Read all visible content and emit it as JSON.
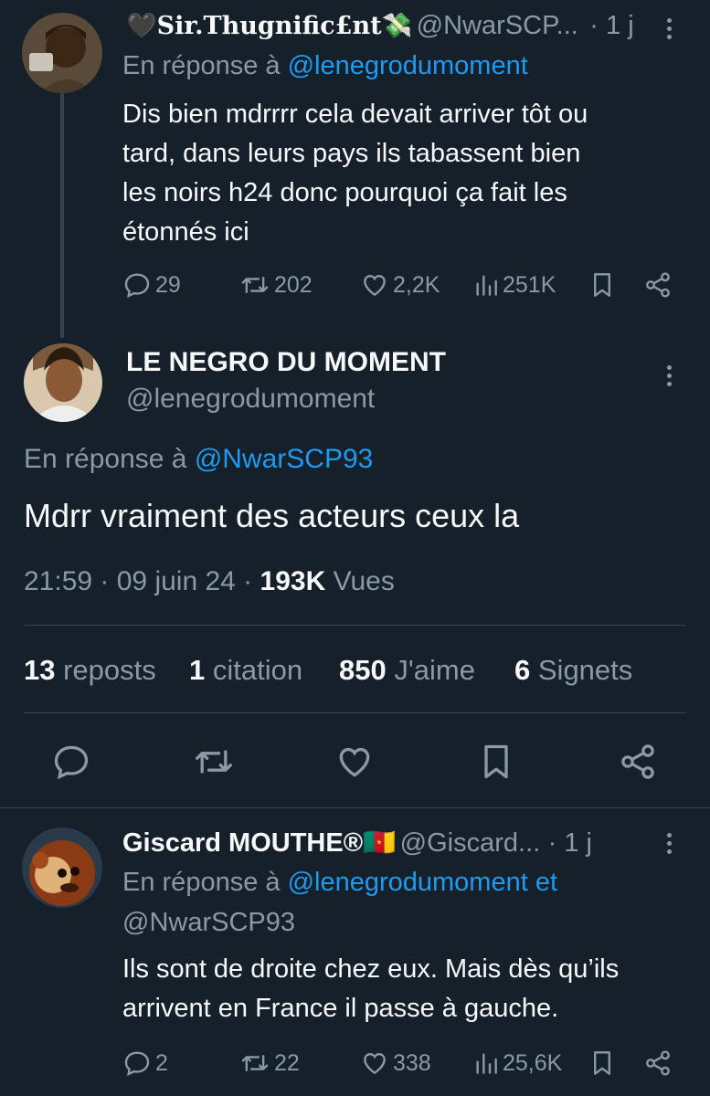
{
  "tweet1": {
    "display_name": "🖤Sir.Thugnific£nt💸",
    "handle": "@NwarSCP...",
    "time": "· 1 j",
    "reply_prefix": "En réponse à",
    "reply_to": "@lenegrodumoment",
    "text_lines": [
      "Dis bien mdrrrr cela devait arriver tôt ou",
      "tard, dans leurs pays ils tabassent bien",
      "les noirs h24 donc pourquoi ça fait les",
      "étonnés ici"
    ],
    "replies": "29",
    "reposts": "202",
    "likes": "2,2K",
    "views": "251K"
  },
  "main_tweet": {
    "display_name": "LE NEGRO DU MOMENT",
    "handle": "@lenegrodumoment",
    "reply_prefix": "En réponse à",
    "reply_to": "@NwarSCP93",
    "text": "Mdrr vraiment des acteurs ceux la",
    "timestamp": "21:59 · 09 juin 24 ·",
    "views_count": "193K",
    "views_label": "Vues",
    "stats": {
      "reposts_count": "13",
      "reposts_label": "reposts",
      "quotes_count": "1",
      "quotes_label": "citation",
      "likes_count": "850",
      "likes_label": "J'aime",
      "bookmarks_count": "6",
      "bookmarks_label": "Signets"
    }
  },
  "tweet3": {
    "display_name": "Giscard MOUTHE®🇨🇲",
    "handle": "@Giscard...",
    "time": "· 1 j",
    "reply_prefix": "En réponse à",
    "reply_to_1": "@lenegrodumoment et",
    "reply_to_2": "@NwarSCP93",
    "text_lines": [
      "Ils sont de droite chez eux. Mais dès qu’ils",
      "arrivent en France il passe à gauche."
    ],
    "replies": "2",
    "reposts": "22",
    "likes": "338",
    "views": "25,6K"
  },
  "colors": {
    "background": "#15202b",
    "text": "#f7f9f9",
    "muted": "#8b98a5",
    "link": "#1d9bf0",
    "divider": "#38444d"
  },
  "icons": [
    "reply-icon",
    "repost-icon",
    "like-icon",
    "views-icon",
    "bookmark-icon",
    "share-icon",
    "more-icon"
  ]
}
